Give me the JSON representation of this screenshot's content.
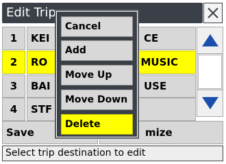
{
  "title": "Edit Trip",
  "icons": {
    "close": "close-icon",
    "scroll_up": "scroll-up-arrow-icon",
    "scroll_down": "scroll-down-arrow-icon"
  },
  "colors": {
    "titlebar": "#3b4048",
    "selected": "#ffff00",
    "button": "#d8d8d8",
    "arrow": "#1a4fb0"
  },
  "list": {
    "rows": [
      {
        "num": "1",
        "left": "KEI",
        "right": "CE"
      },
      {
        "num": "2",
        "left": "RO",
        "right": "F MUSIC"
      },
      {
        "num": "3",
        "left": "BAI",
        "right": "USE"
      },
      {
        "num": "4",
        "left": "STF",
        "right": ""
      }
    ]
  },
  "bottom": {
    "save_label": "Save",
    "optimize_label": "mize"
  },
  "status": "Select trip destination to edit",
  "menu": {
    "items": [
      "Cancel",
      "Add",
      "Move Up",
      "Move Down",
      "Delete"
    ]
  }
}
